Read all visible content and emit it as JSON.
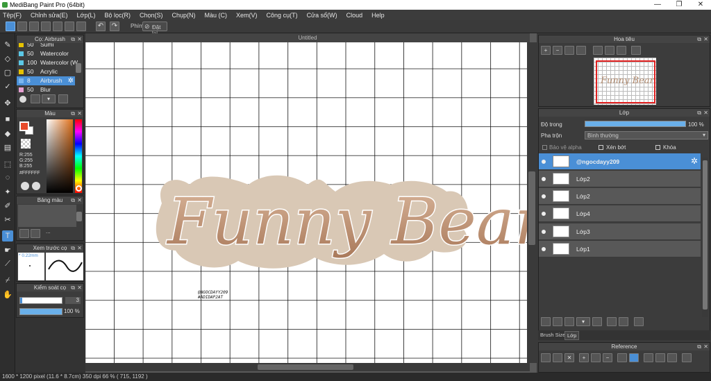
{
  "app": {
    "title": "MediBang Paint Pro (64bit)"
  },
  "menu": [
    "Tệp(F)",
    "Chỉnh sửa(E)",
    "Lớp(L)",
    "Bộ lọc(R)",
    "Chọn(S)",
    "Chụp(N)",
    "Màu (C)",
    "Xem(V)",
    "Công cụ(T)",
    "Cửa sổ(W)",
    "Cloud",
    "Help"
  ],
  "toolbar": {
    "brush_label": "Phím",
    "reset_label": "Đặt lại"
  },
  "brush_panel": {
    "title": "Cọ: Airbrush",
    "items": [
      {
        "size": "50",
        "name": "Sumi",
        "color": "#e6c200"
      },
      {
        "size": "50",
        "name": "Watercolor",
        "color": "#5cc8e6"
      },
      {
        "size": "100",
        "name": "Watercolor (W",
        "color": "#5cc8e6"
      },
      {
        "size": "50",
        "name": "Acrylic",
        "color": "#e6c200"
      },
      {
        "size": "8",
        "name": "Airbrush",
        "color": "#7ab6f0"
      },
      {
        "size": "50",
        "name": "Blur",
        "color": "#e6a0d2"
      }
    ]
  },
  "color_panel": {
    "title": "Màu",
    "r": "R:255",
    "g": "G:255",
    "b": "B:255",
    "hex": "#FFFFFF"
  },
  "palette_panel": {
    "title": "Bảng màu",
    "dots": "..."
  },
  "preview_panel": {
    "title": "Xem trước cọ",
    "size": "* 0.22mm"
  },
  "control_panel": {
    "title": "Kiểm soát cọ",
    "size_value": "3",
    "opacity_value": "100 %"
  },
  "document": {
    "tab": "Untitled",
    "artwork_text": "Funny Bear",
    "signature1": "@NGOCDAYY209",
    "signature2": "#ADIDAP2AT"
  },
  "navigator": {
    "title": "Hoa tiêu",
    "thumb_text": "Funny Bear"
  },
  "layer_panel": {
    "title": "Lớp",
    "opacity_label": "Độ trong",
    "opacity_value": "100 %",
    "blend_label": "Pha trộn",
    "blend_value": "Bình thường",
    "protect_alpha": "Bảo vệ alpha",
    "clipping": "Xén bớt",
    "lock": "Khóa",
    "layers": [
      "@ngocdayy209",
      "Lớp2",
      "Lớp2",
      "Lớp4",
      "Lớp3",
      "Lớp1"
    ]
  },
  "bottom_tabs": {
    "brush_size": "Brush Size",
    "layer": "Lớp"
  },
  "reference_panel": {
    "title": "Reference"
  },
  "status": {
    "text": "1600 * 1200 pixel   (11.6 * 8.7cm)   350 dpi   66 %   ( 715, 1192 )"
  },
  "colors": {
    "accent": "#4a8fd6",
    "fg_color": "#e84a2a",
    "bg_color": "#ffffff",
    "bear_fill": "#c09a7e",
    "bear_shadow": "#d9c8b5"
  }
}
